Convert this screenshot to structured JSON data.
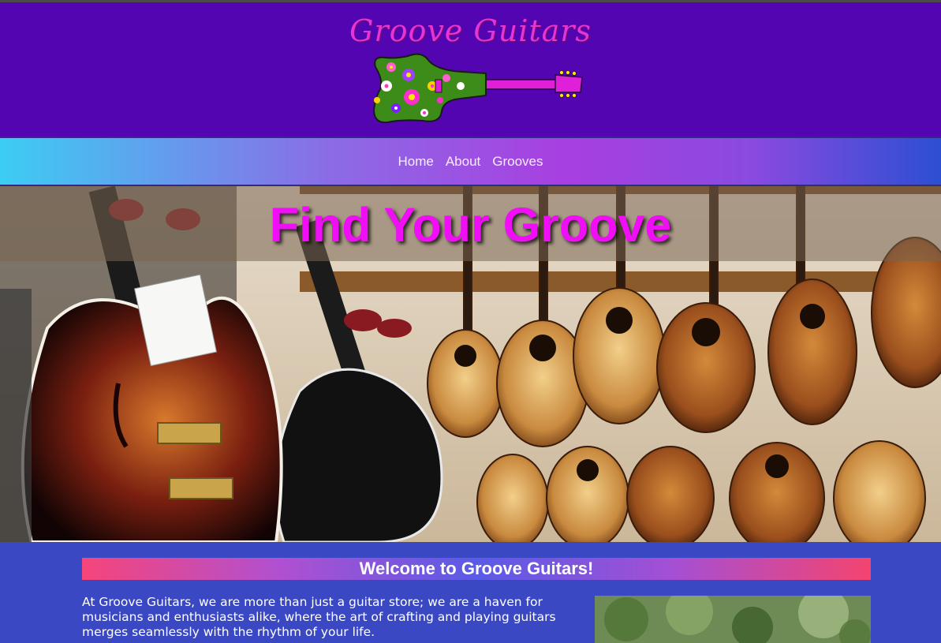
{
  "header": {
    "logo_text": "Groove Guitars"
  },
  "nav": {
    "items": [
      {
        "label": "Home"
      },
      {
        "label": "About"
      },
      {
        "label": "Grooves"
      }
    ]
  },
  "hero": {
    "title": "Find Your Groove"
  },
  "main": {
    "welcome_heading": "Welcome to Groove Guitars!",
    "intro_paragraph": "At Groove Guitars, we are more than just a guitar store; we are a haven for musicians and enthusiasts alike, where the art of crafting and playing guitars merges seamlessly with the rhythm of your life."
  },
  "colors": {
    "header_bg": "#5205b0",
    "logo_pink": "#e535d6",
    "hero_title": "#ef0ef5",
    "content_bg": "#3a48c4"
  }
}
